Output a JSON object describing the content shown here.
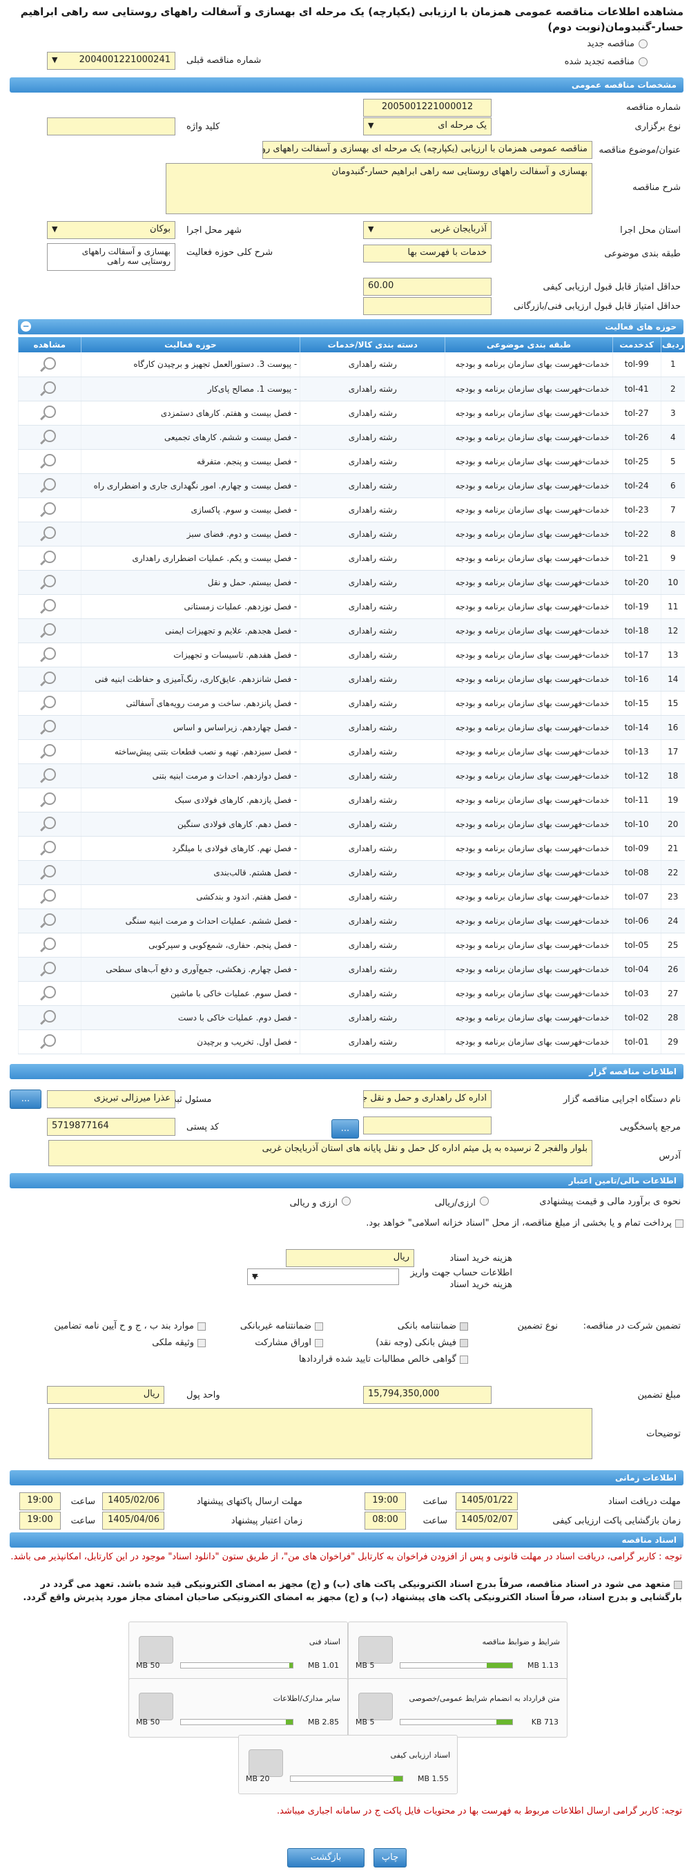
{
  "title": "مشاهده اطلاعات مناقصه عمومی همزمان با ارزیابی (یکپارچه) یک مرحله ای بهسازی و آسفالت راههای روستایی سه راهی ابراهیم حسار-گنبدومان(نوبت دوم)",
  "radios": {
    "new": "مناقصه جدید",
    "renewed": "مناقصه تجدید شده"
  },
  "prev_number_label": "شماره مناقصه قبلی",
  "prev_number": "2004001221000241",
  "sections": {
    "general": "مشخصات مناقصه عمومی",
    "activities": "حوزه های فعالیت",
    "tenderer": "اطلاعات مناقصه گزار",
    "finance": "اطلاعات مالی/تامین اعتبار",
    "timing": "اطلاعات زمانی",
    "documents": "اسناد مناقصه"
  },
  "general": {
    "number_label": "شماره مناقصه",
    "number": "2005001221000012",
    "type_label": "نوع برگزاری",
    "type": "یک مرحله ای",
    "keyword_label": "کلید واژه",
    "keyword": "",
    "subject_label": "عنوان/موضوع مناقصه",
    "subject": "مناقصه عمومی همزمان با ارزیابی (یکپارچه) یک مرحله ای بهسازی و آسفالت راههای روستایی سه راهی ابراهیم حسار-گنبدومان",
    "desc_label": "شرح مناقصه",
    "desc": "بهسازی و آسفالت راههای روستایی سه راهی ابراهیم حسار-گنبدومان",
    "province_label": "استان محل اجرا",
    "province": "آذربایجان غربی",
    "city_label": "شهر محل اجرا",
    "city": "بوکان",
    "category_label": "طبقه بندی موضوعی",
    "category": "خدمات با فهرست بها",
    "scope_label": "شرح کلی حوزه فعالیت",
    "scope": "بهسازی و آسفالت راههای روستایی سه راهی",
    "min_quality_label": "حداقل امتیاز قابل قبول ارزیابی کیفی",
    "min_quality": "60.00",
    "min_tech_label": "حداقل امتیاز قابل قبول ارزیابی فنی/بازرگانی",
    "min_tech": ""
  },
  "table": {
    "headers": {
      "idx": "ردیف",
      "code": "کدخدمت",
      "cls": "طبقه بندی موضوعی",
      "cat": "دسته بندی کالا/خدمات",
      "act": "حوزه فعالیت",
      "view": "مشاهده"
    },
    "rows": [
      {
        "idx": "1",
        "code": "tol-99",
        "cls": "خدمات-فهرست بهای سازمان برنامه و بودجه",
        "cat": "رشته راهداری",
        "act": "- پیوست 3. دستورالعمل تجهیز و برچیدن کارگاه"
      },
      {
        "idx": "2",
        "code": "tol-41",
        "cls": "خدمات-فهرست بهای سازمان برنامه و بودجه",
        "cat": "رشته راهداری",
        "act": "- پیوست 1. مصالح پای‌کار"
      },
      {
        "idx": "3",
        "code": "tol-27",
        "cls": "خدمات-فهرست بهای سازمان برنامه و بودجه",
        "cat": "رشته راهداری",
        "act": "- فصل بیست و هفتم. کارهای دستمزدی"
      },
      {
        "idx": "4",
        "code": "tol-26",
        "cls": "خدمات-فهرست بهای سازمان برنامه و بودجه",
        "cat": "رشته راهداری",
        "act": "- فصل بیست و ششم. کارهای تجمیعی"
      },
      {
        "idx": "5",
        "code": "tol-25",
        "cls": "خدمات-فهرست بهای سازمان برنامه و بودجه",
        "cat": "رشته راهداری",
        "act": "- فصل بیست و پنجم. متفرقه"
      },
      {
        "idx": "6",
        "code": "tol-24",
        "cls": "خدمات-فهرست بهای سازمان برنامه و بودجه",
        "cat": "رشته راهداری",
        "act": "- فصل بیست و چهارم. امور نگهداری جاری و اضطراری راه"
      },
      {
        "idx": "7",
        "code": "tol-23",
        "cls": "خدمات-فهرست بهای سازمان برنامه و بودجه",
        "cat": "رشته راهداری",
        "act": "- فصل بیست و سوم. پاکسازی"
      },
      {
        "idx": "8",
        "code": "tol-22",
        "cls": "خدمات-فهرست بهای سازمان برنامه و بودجه",
        "cat": "رشته راهداری",
        "act": "- فصل بیست و دوم. فضای سبز"
      },
      {
        "idx": "9",
        "code": "tol-21",
        "cls": "خدمات-فهرست بهای سازمان برنامه و بودجه",
        "cat": "رشته راهداری",
        "act": "- فصل بیست و یکم. عملیات اضطراری راهداری"
      },
      {
        "idx": "10",
        "code": "tol-20",
        "cls": "خدمات-فهرست بهای سازمان برنامه و بودجه",
        "cat": "رشته راهداری",
        "act": "- فصل بیستم. حمل و نقل"
      },
      {
        "idx": "11",
        "code": "tol-19",
        "cls": "خدمات-فهرست بهای سازمان برنامه و بودجه",
        "cat": "رشته راهداری",
        "act": "- فصل نوزدهم. عملیات زمستانی"
      },
      {
        "idx": "12",
        "code": "tol-18",
        "cls": "خدمات-فهرست بهای سازمان برنامه و بودجه",
        "cat": "رشته راهداری",
        "act": "- فصل هجدهم. علایم و تجهیزات ایمنی"
      },
      {
        "idx": "13",
        "code": "tol-17",
        "cls": "خدمات-فهرست بهای سازمان برنامه و بودجه",
        "cat": "رشته راهداری",
        "act": "- فصل هفدهم. تاسیسات و تجهیزات"
      },
      {
        "idx": "14",
        "code": "tol-16",
        "cls": "خدمات-فهرست بهای سازمان برنامه و بودجه",
        "cat": "رشته راهداری",
        "act": "- فصل شانزدهم. عایق‌کاری، رنگ‌آمیزی و حفاظت ابنیه فنی"
      },
      {
        "idx": "15",
        "code": "tol-15",
        "cls": "خدمات-فهرست بهای سازمان برنامه و بودجه",
        "cat": "رشته راهداری",
        "act": "- فصل پانزدهم. ساخت و مرمت رویه‌های آسفالتی"
      },
      {
        "idx": "16",
        "code": "tol-14",
        "cls": "خدمات-فهرست بهای سازمان برنامه و بودجه",
        "cat": "رشته راهداری",
        "act": "- فصل چهاردهم. زیراساس و اساس"
      },
      {
        "idx": "17",
        "code": "tol-13",
        "cls": "خدمات-فهرست بهای سازمان برنامه و بودجه",
        "cat": "رشته راهداری",
        "act": "- فصل سیزدهم. تهیه و نصب قطعات بتنی پیش‌ساخته"
      },
      {
        "idx": "18",
        "code": "tol-12",
        "cls": "خدمات-فهرست بهای سازمان برنامه و بودجه",
        "cat": "رشته راهداری",
        "act": "- فصل دوازدهم. احداث و مرمت ابنیه بتنی"
      },
      {
        "idx": "19",
        "code": "tol-11",
        "cls": "خدمات-فهرست بهای سازمان برنامه و بودجه",
        "cat": "رشته راهداری",
        "act": "- فصل یازدهم. کارهای فولادی سبک"
      },
      {
        "idx": "20",
        "code": "tol-10",
        "cls": "خدمات-فهرست بهای سازمان برنامه و بودجه",
        "cat": "رشته راهداری",
        "act": "- فصل دهم. کارهای فولادی سنگین"
      },
      {
        "idx": "21",
        "code": "tol-09",
        "cls": "خدمات-فهرست بهای سازمان برنامه و بودجه",
        "cat": "رشته راهداری",
        "act": "- فصل نهم. کارهای فولادی با میلگرد"
      },
      {
        "idx": "22",
        "code": "tol-08",
        "cls": "خدمات-فهرست بهای سازمان برنامه و بودجه",
        "cat": "رشته راهداری",
        "act": "- فصل هشتم. قالب‌بندی"
      },
      {
        "idx": "23",
        "code": "tol-07",
        "cls": "خدمات-فهرست بهای سازمان برنامه و بودجه",
        "cat": "رشته راهداری",
        "act": "- فصل هفتم. اندود و بندکشی"
      },
      {
        "idx": "24",
        "code": "tol-06",
        "cls": "خدمات-فهرست بهای سازمان برنامه و بودجه",
        "cat": "رشته راهداری",
        "act": "- فصل ششم. عملیات احداث و مرمت ابنیه سنگی"
      },
      {
        "idx": "25",
        "code": "tol-05",
        "cls": "خدمات-فهرست بهای سازمان برنامه و بودجه",
        "cat": "رشته راهداری",
        "act": "- فصل پنجم. حفاری، شمع‌کوبی و سپرکوبی"
      },
      {
        "idx": "26",
        "code": "tol-04",
        "cls": "خدمات-فهرست بهای سازمان برنامه و بودجه",
        "cat": "رشته راهداری",
        "act": "- فصل چهارم. زهکشی، جمع‌آوری و دفع آب‌های سطحی"
      },
      {
        "idx": "27",
        "code": "tol-03",
        "cls": "خدمات-فهرست بهای سازمان برنامه و بودجه",
        "cat": "رشته راهداری",
        "act": "- فصل سوم. عملیات خاکی با ماشین"
      },
      {
        "idx": "28",
        "code": "tol-02",
        "cls": "خدمات-فهرست بهای سازمان برنامه و بودجه",
        "cat": "رشته راهداری",
        "act": "- فصل دوم. عملیات خاکی با دست"
      },
      {
        "idx": "29",
        "code": "tol-01",
        "cls": "خدمات-فهرست بهای سازمان برنامه و بودجه",
        "cat": "رشته راهداری",
        "act": "- فصل اول. تخریب و برچیدن"
      }
    ]
  },
  "tenderer": {
    "org_label": "نام دستگاه اجرایی مناقصه گزار",
    "org": "اداره کل راهداری و حمل و نقل جاده ای",
    "officer_label": "مسئول ثبت مناقصه",
    "officer": "عذرا میرزالی تبریزی",
    "ref_label": "مرجع پاسخگویی",
    "ref": "",
    "postal_label": "کد پستی",
    "postal": "5719877164",
    "address_label": "آدرس",
    "address": "بلوار والفجر 2 نرسیده به پل میثم اداره کل حمل و نقل پایانه های استان آذربایجان غربی",
    "btn": "..."
  },
  "finance": {
    "estimate_label": "نحوه ی برآورد مالی و قیمت پیشنهادی",
    "opt1": "ارزی/ریالی",
    "opt2": "ارزی و ریالی",
    "treasury_text": "پرداخت تمام و یا بخشی از مبلغ مناقصه، از محل \"اسناد خزانه اسلامی\" خواهد بود.",
    "doc_fee_label": "هزینه خرید اسناد",
    "doc_fee_unit": "ریال",
    "acct_label": "اطلاعات حساب جهت واریز هزینه خرید اسناد",
    "acct": "--",
    "guarantee_label": "تضمین شرکت در مناقصه:",
    "type_label": "نوع تضمین",
    "g1": "ضمانتنامه بانکی",
    "g2": "ضمانتنامه غیربانکی",
    "g3": "موارد بند ب ، ج و ح آیین نامه تضامین",
    "g4": "فیش بانکی (وجه نقد)",
    "g5": "اوراق مشارکت",
    "g6": "وثیقه ملکی",
    "g7": "گواهی خالص مطالبات تایید شده قراردادها",
    "amount_label": "مبلغ تضمین",
    "amount": "15,794,350,000",
    "currency_label": "واحد پول",
    "currency": "ریال",
    "desc_label": "توضیحات",
    "desc": ""
  },
  "timing": {
    "receive_label": "مهلت دریافت اسناد",
    "receive_date": "1405/01/22",
    "receive_time": "19:00",
    "send_label": "مهلت ارسال پاکتهای پیشنهاد",
    "send_date": "1405/02/06",
    "send_time": "19:00",
    "open_label": "زمان بازگشایی پاکت ارزیابی کیفی",
    "open_date": "1405/02/07",
    "open_time": "08:00",
    "valid_label": "زمان اعتبار پیشنهاد",
    "valid_date": "1405/04/06",
    "valid_time": "19:00",
    "time_word": "ساعت"
  },
  "documents": {
    "note1": "توجه : کاربر گرامی، دریافت اسناد در مهلت قانونی و پس از افزودن فراخوان به کارتابل \"فراخوان های من\"، از طریق ستون \"دانلود اسناد\" موجود در این کارتابل، امکانپذیر می باشد.",
    "note2": "متعهد می شود در اسناد مناقصه، صرفاً بدرج اسناد الکترونیکی پاکت های (ب) و (ج) مجهز به امضای الکترونیکی قید شده باشد. تعهد می گردد در بارگشایی و بدرج اسناد، صرفاً اسناد الکترونیکی پاکت های پیشنهاد (ب) و (ج) مجهز به امضای الکترونیکی صاحبان امضای مجاز مورد پذیرش واقع گردد.",
    "files": [
      {
        "name": "شرایط و ضوابط مناقصه",
        "size": "1.13 MB",
        "max": "5 MB",
        "pct": 23
      },
      {
        "name": "اسناد فنی",
        "size": "1.01 MB",
        "max": "50 MB",
        "pct": 3
      },
      {
        "name": "متن قرارداد به انضمام شرایط عمومی/خصوصی",
        "size": "713 KB",
        "max": "5 MB",
        "pct": 14
      },
      {
        "name": "سایر مدارک/اطلاعات",
        "size": "2.85 MB",
        "max": "50 MB",
        "pct": 6
      },
      {
        "name": "اسناد ارزیابی کیفی",
        "size": "1.55 MB",
        "max": "20 MB",
        "pct": 8
      }
    ],
    "note3": "توجه: کاربر گرامی ارسال اطلاعات مربوط به فهرست بها در محتویات فایل پاکت ج در سامانه اجباری میباشد."
  },
  "buttons": {
    "print": "چاپ",
    "back": "بازگشت"
  }
}
